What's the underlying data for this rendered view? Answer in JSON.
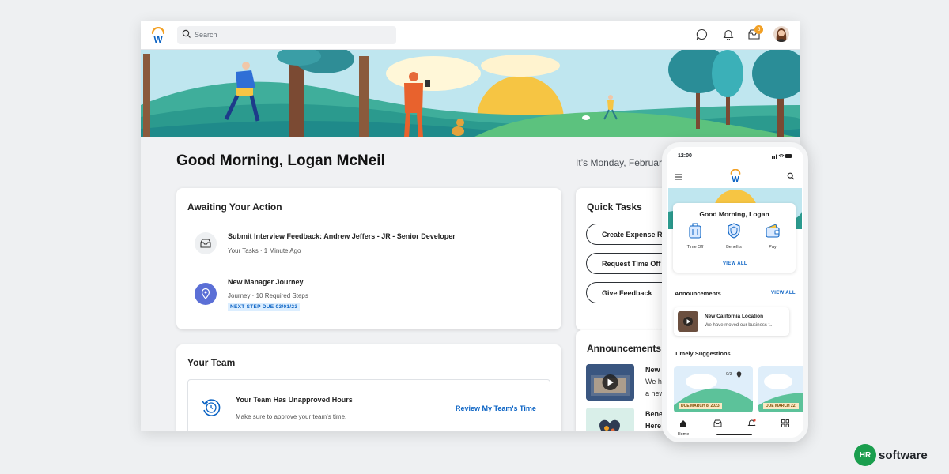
{
  "topbar": {
    "search_placeholder": "Search",
    "inbox_badge": "5"
  },
  "greeting": "Good Morning, Logan McNeil",
  "date_text": "It’s Monday, February",
  "awaiting": {
    "title": "Awaiting Your Action",
    "items": [
      {
        "title": "Submit Interview Feedback: Andrew Jeffers - JR - Senior Developer",
        "sub": "Your Tasks · 1 Minute Ago"
      },
      {
        "title": "New Manager Journey",
        "sub": "Journey · 10 Required Steps",
        "tag": "NEXT STEP DUE 03/01/23"
      }
    ]
  },
  "team": {
    "title": "Your Team",
    "alert_title": "Your Team Has Unapproved Hours",
    "alert_sub": "Make sure to approve your team's time.",
    "action": "Review My Team's Time"
  },
  "quick_tasks": {
    "title": "Quick Tasks",
    "buttons": [
      "Create Expense Re",
      "Request Time Off",
      "Give Feedback"
    ]
  },
  "announcements": {
    "title": "Announcements",
    "items": [
      {
        "line1": "New",
        "line2": "We h",
        "line3": "a new"
      },
      {
        "line1": "Bene",
        "line2": "Here"
      }
    ]
  },
  "phone": {
    "time": "12:00",
    "greeting": "Good Morning, Logan",
    "quick": [
      "Time Off",
      "Benefits",
      "Pay"
    ],
    "view_all": "VIEW ALL",
    "announcements_title": "Announcements",
    "announcements_view_all": "VIEW ALL",
    "announcement": {
      "title": "New California Location",
      "sub": "We have moved our business t..."
    },
    "suggestions_title": "Timely Suggestions",
    "suggestion_count": "0/3",
    "due1": "DUE MARCH 8, 2023",
    "due2": "DUE MARCH 22,",
    "nav_home": "Home"
  },
  "brand": {
    "mark": "HR",
    "word": "software"
  },
  "colors": {
    "accent": "#0b63c4",
    "journey_icon": "#5b6fd6",
    "badge": "#f2a024",
    "brand_green": "#1a9e4e"
  }
}
